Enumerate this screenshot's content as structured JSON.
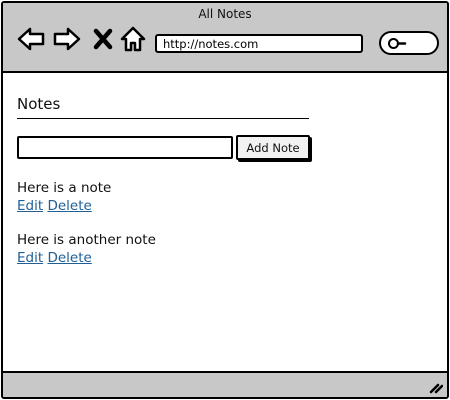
{
  "window": {
    "title": "All Notes"
  },
  "toolbar": {
    "back_icon": "arrow-left-icon",
    "forward_icon": "arrow-right-icon",
    "stop_icon": "close-icon",
    "home_icon": "home-icon",
    "url": "http://notes.com",
    "search_icon": "search-icon"
  },
  "page": {
    "title": "Notes",
    "new_note": {
      "value": "",
      "placeholder": ""
    },
    "add_button_label": "Add Note"
  },
  "notes": [
    {
      "text": "Here is a note",
      "edit_label": "Edit",
      "delete_label": "Delete"
    },
    {
      "text": "Here is another note",
      "edit_label": "Edit",
      "delete_label": "Delete"
    }
  ],
  "colors": {
    "chrome": "#c8c8c8",
    "link": "#1f5f96",
    "border": "#000000"
  }
}
